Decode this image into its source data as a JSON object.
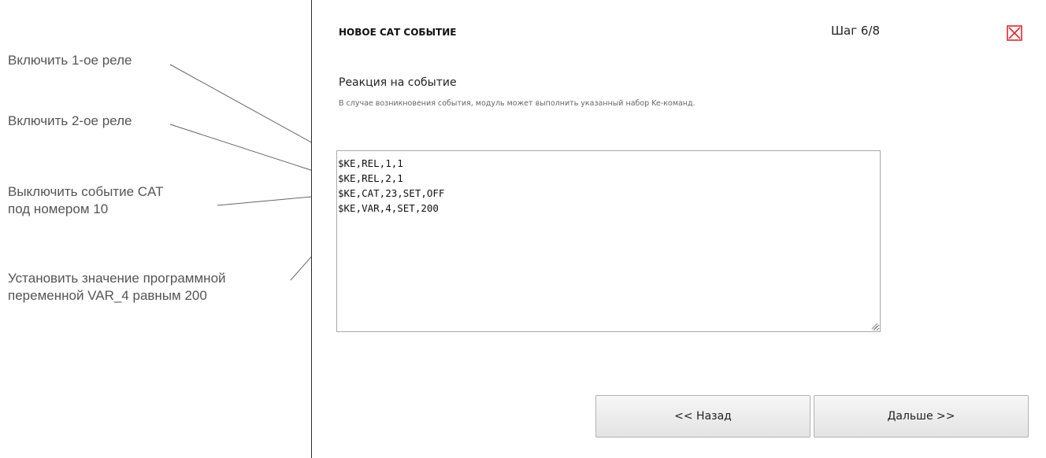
{
  "annotations": {
    "relay1": "Включить 1-ое реле",
    "relay2": "Включить 2-ое реле",
    "cat_line1": "Выключить событие CAT",
    "cat_line2": "под номером 10",
    "var_line1": "Установить значение программной",
    "var_line2": "переменной VAR_4 равным 200"
  },
  "dialog": {
    "title": "НОВОЕ САТ СОБЫТИЕ",
    "step": "Шаг 6/8",
    "close_icon": "close-x-icon",
    "close_color": "#e8262b",
    "section_heading": "Реакция на событие",
    "section_hint": "В случае возникновения события, модуль может выполнить указанный набор Ke-команд.",
    "commands": "$KE,REL,1,1\n$KE,REL,2,1\n$KE,CAT,23,SET,OFF\n$KE,VAR,4,SET,200",
    "back_label": "<< Назад",
    "next_label": "Дальше >>"
  }
}
